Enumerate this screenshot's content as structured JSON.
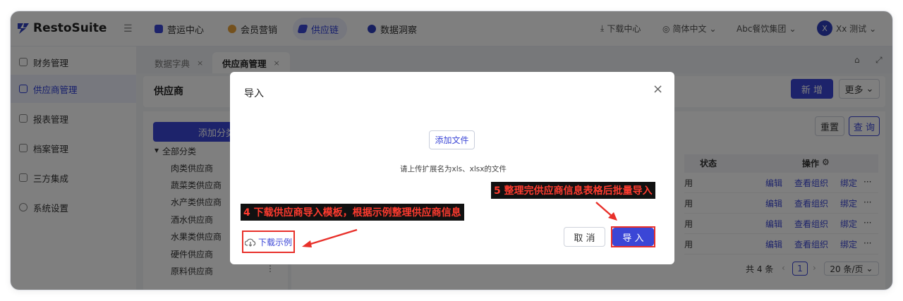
{
  "app": {
    "brand": "RestoSuite",
    "nav": [
      {
        "label": "营运中心",
        "color": "#3b46d6"
      },
      {
        "label": "会员营销",
        "color": "#3b46d6"
      },
      {
        "label": "供应链",
        "color": "#3b46d6"
      },
      {
        "label": "数据洞察",
        "color": "#3b46d6"
      }
    ],
    "download_center": "下载中心",
    "language": "简体中文",
    "org": "Abc餐饮集团",
    "avatar_letter": "X",
    "user": "Xx 测试"
  },
  "sidebar": {
    "items": [
      {
        "label": "财务管理"
      },
      {
        "label": "供应商管理"
      },
      {
        "label": "报表管理"
      },
      {
        "label": "档案管理"
      },
      {
        "label": "三方集成"
      },
      {
        "label": "系统设置"
      }
    ]
  },
  "tabs": [
    {
      "label": "数据字典",
      "close": "×"
    },
    {
      "label": "供应商管理",
      "close": "×"
    }
  ],
  "page": {
    "title": "供应商",
    "new_button": "新 增",
    "more_button": "更多",
    "add_category": "添加分类",
    "all_categories": "全部分类",
    "categories": [
      "肉类供应商",
      "蔬菜类供应商",
      "水产类供应商",
      "酒水供应商",
      "水果类供应商",
      "硬件供应商",
      "原料供应商"
    ],
    "reset_button": "重置",
    "query_button": "查 询",
    "columns": {
      "status": "状态",
      "actions": "操作"
    },
    "rows": [
      {
        "status": "用",
        "edit": "编辑",
        "view": "查看组织",
        "bind": "绑定",
        "more": "···"
      },
      {
        "status": "用",
        "edit": "编辑",
        "view": "查看组织",
        "bind": "绑定",
        "more": "···"
      },
      {
        "status": "用",
        "edit": "编辑",
        "view": "查看组织",
        "bind": "绑定",
        "more": "···"
      },
      {
        "status": "用",
        "edit": "编辑",
        "view": "查看组织",
        "bind": "绑定",
        "more": "···"
      }
    ],
    "pagination": {
      "total": "共 4 条",
      "current": "1",
      "page_size": "20 条/页"
    }
  },
  "modal": {
    "title": "导入",
    "close": "×",
    "add_file": "添加文件",
    "hint": "请上传扩展名为xls、xlsx的文件",
    "download_example": "下载示例",
    "cancel": "取 消",
    "import": "导 入"
  },
  "annotations": {
    "step4": "4 下载供应商导入模板，根据示例整理供应商信息",
    "step5": "5 整理完供应商信息表格后批量导入",
    "color": "#e8302a"
  }
}
